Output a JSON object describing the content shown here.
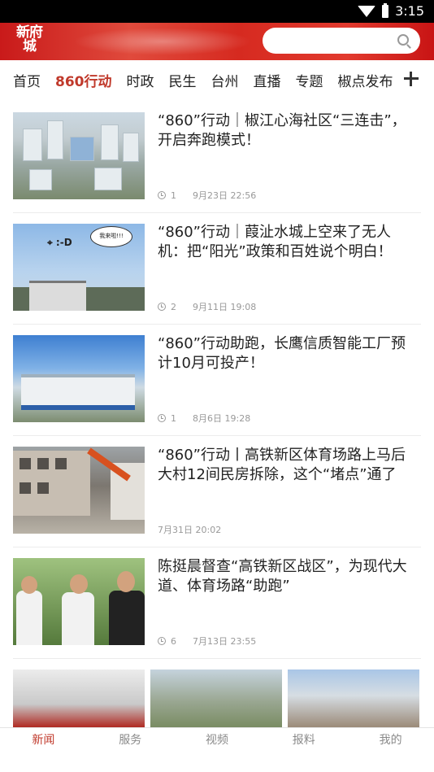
{
  "status_bar": {
    "time": "3:15"
  },
  "header": {
    "logo_text": "新府城",
    "search": {
      "placeholder": ""
    }
  },
  "tabs": [
    {
      "label": "首页",
      "active": false
    },
    {
      "label": "860行动",
      "active": true
    },
    {
      "label": "时政",
      "active": false
    },
    {
      "label": "民生",
      "active": false
    },
    {
      "label": "台州",
      "active": false
    },
    {
      "label": "直播",
      "active": false
    },
    {
      "label": "专题",
      "active": false
    },
    {
      "label": "椒点发布",
      "active": false
    }
  ],
  "news": [
    {
      "title": "“860”行动｜椒江心海社区“三连击”，开启奔跑模式！",
      "views": "1",
      "time": "9月23日 22:56",
      "image": "aerial-city-render"
    },
    {
      "title": "“860”行动｜葭沚水城上空来了无人机：把“阳光”政策和百姓说个明白！",
      "views": "2",
      "time": "9月11日 19:08",
      "image": "drone-over-houses",
      "bubble_text": "我来啦!!!"
    },
    {
      "title": "“860”行动助跑，长鹰信质智能工厂预计10月可投产！",
      "views": "1",
      "time": "8月6日 19:28",
      "image": "factory-building"
    },
    {
      "title": "“860”行动丨高铁新区体育场路上马后大村12间民房拆除，这个“堵点”通了",
      "views": "",
      "time": "7月31日 20:02",
      "image": "house-demolition"
    },
    {
      "title": "陈挺晨督查“高铁新区战区”，为现代大道、体育场路“助跑”",
      "views": "6",
      "time": "7月13日 23:55",
      "image": "officials-inspection"
    }
  ],
  "image_row": [
    "meeting-room",
    "aerial-residential",
    "industrial-buildings"
  ],
  "bottom_nav": [
    {
      "label": "新闻",
      "active": true
    },
    {
      "label": "服务",
      "active": false
    },
    {
      "label": "视频",
      "active": false
    },
    {
      "label": "报料",
      "active": false
    },
    {
      "label": "我的",
      "active": false
    }
  ],
  "colors": {
    "accent": "#c0392b",
    "header_red": "#d62a20"
  }
}
